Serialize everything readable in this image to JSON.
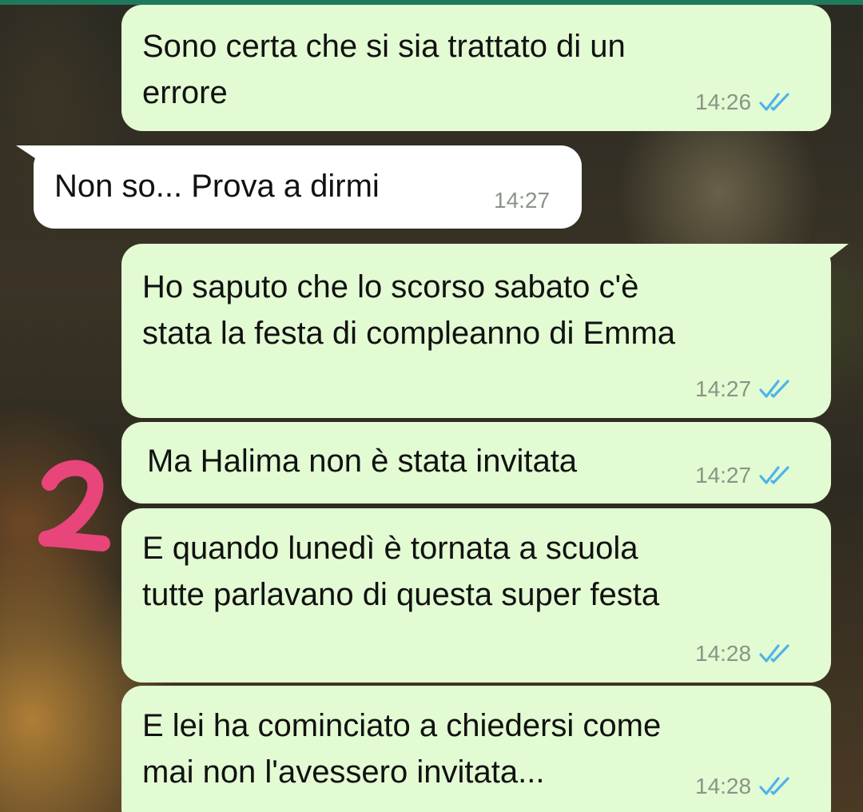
{
  "messages": [
    {
      "direction": "outgoing",
      "text": "Sono certa che si sia trattato di un\nerrore",
      "time": "14:26",
      "status": "read",
      "ticks_icon": "double-check-icon"
    },
    {
      "direction": "incoming",
      "text": "Non so... Prova a dirmi",
      "time": "14:27"
    },
    {
      "direction": "outgoing",
      "text": "Ho saputo che lo scorso sabato c'è\nstata la festa di compleanno di Emma",
      "time": "14:27",
      "status": "read",
      "ticks_icon": "double-check-icon"
    },
    {
      "direction": "outgoing",
      "text": "Ma Halima non è stata invitata",
      "time": "14:27",
      "status": "read",
      "ticks_icon": "double-check-icon"
    },
    {
      "direction": "outgoing",
      "text": "E quando lunedì è tornata a scuola\ntutte parlavano di questa super festa",
      "time": "14:28",
      "status": "read",
      "ticks_icon": "double-check-icon"
    },
    {
      "direction": "outgoing",
      "text": "E lei ha cominciato a chiedersi come\nmai non l'avessero invitata...",
      "time": "14:28",
      "status": "read",
      "ticks_icon": "double-check-icon"
    }
  ],
  "annotation": {
    "text": "2",
    "color": "#e8457a"
  },
  "colors": {
    "outgoing_bubble": "#e2fbd3",
    "incoming_bubble": "#ffffff",
    "read_ticks": "#4fb3e8",
    "timestamp": "#8a9486",
    "top_bar": "#1f7a5c"
  }
}
